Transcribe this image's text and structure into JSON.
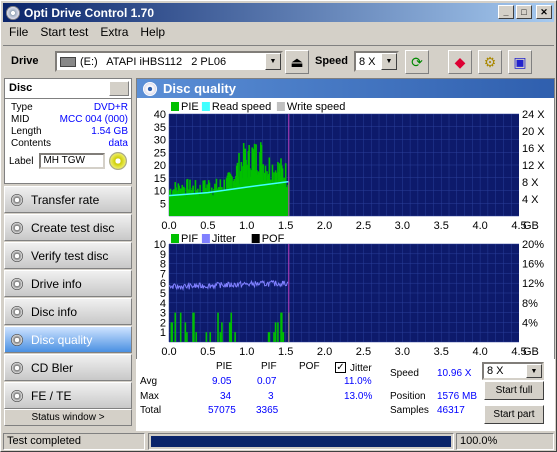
{
  "window": {
    "title": "Opti Drive Control 1.70"
  },
  "menu": [
    "File",
    "Start test",
    "Extra",
    "Help"
  ],
  "toolbar": {
    "drive_label": "Drive",
    "drive_value": "(E:)   ATAPI iHBS112   2 PL06",
    "speed_label": "Speed",
    "speed_value": "8 X"
  },
  "disc": {
    "header": "Disc",
    "rows": [
      {
        "k": "Type",
        "v": "DVD+R"
      },
      {
        "k": "MID",
        "v": "MCC 004 (000)"
      },
      {
        "k": "Length",
        "v": "1.54 GB"
      },
      {
        "k": "Contents",
        "v": "data"
      }
    ],
    "label_key": "Label",
    "label_value": "MH TGW"
  },
  "nav": [
    "Transfer rate",
    "Create test disc",
    "Verify test disc",
    "Drive info",
    "Disc info",
    "Disc quality",
    "CD Bler",
    "FE / TE"
  ],
  "nav_active": 5,
  "status_window": "Status window >",
  "panel_title": "Disc quality",
  "chart_data": [
    {
      "type": "bar",
      "legend": [
        {
          "name": "PIE",
          "color": "#00c000"
        },
        {
          "name": "Read speed",
          "color": "#40ffff"
        },
        {
          "name": "Write speed",
          "color": "#c0c0c0"
        }
      ],
      "xlabel_unit": "GB",
      "xlim": [
        0,
        4.5
      ],
      "xticks": [
        "0.0",
        "0.5",
        "1.0",
        "1.5",
        "2.0",
        "2.5",
        "3.0",
        "3.5",
        "4.0",
        "4.5"
      ],
      "ylim": [
        0,
        40
      ],
      "yticks_left": [
        "5",
        "10",
        "15",
        "20",
        "25",
        "30",
        "35",
        "40"
      ],
      "yticks_right": [
        "4 X",
        "8 X",
        "12 X",
        "16 X",
        "20 X",
        "24 X"
      ],
      "pie_profile": [
        [
          0,
          12
        ],
        [
          0.2,
          13
        ],
        [
          0.4,
          12
        ],
        [
          0.5,
          14
        ],
        [
          0.6,
          13
        ],
        [
          0.75,
          15
        ],
        [
          0.85,
          20
        ],
        [
          0.95,
          25
        ],
        [
          1.0,
          24
        ],
        [
          1.05,
          28
        ],
        [
          1.1,
          26
        ],
        [
          1.15,
          30
        ],
        [
          1.2,
          24
        ],
        [
          1.3,
          22
        ],
        [
          1.4,
          21
        ],
        [
          1.5,
          19
        ],
        [
          1.54,
          18
        ]
      ],
      "read_speed": [
        [
          0,
          4.8
        ],
        [
          0.5,
          5.5
        ],
        [
          1.0,
          6.8
        ],
        [
          1.54,
          8.1
        ]
      ]
    },
    {
      "type": "bar",
      "legend": [
        {
          "name": "PIF",
          "color": "#00c000"
        },
        {
          "name": "Jitter",
          "color": "#8080ff"
        },
        {
          "name": "POF",
          "color": "#000000"
        }
      ],
      "xlabel_unit": "GB",
      "xlim": [
        0,
        4.5
      ],
      "xticks": [
        "0.0",
        "0.5",
        "1.0",
        "1.5",
        "2.0",
        "2.5",
        "3.0",
        "3.5",
        "4.0",
        "4.5"
      ],
      "ylim": [
        0,
        10
      ],
      "yticks_left": [
        "1",
        "2",
        "3",
        "4",
        "5",
        "6",
        "7",
        "8",
        "9",
        "10"
      ],
      "yticks_right": [
        "4%",
        "8%",
        "12%",
        "16%",
        "20%"
      ],
      "jitter_pct": [
        [
          0,
          11.2
        ],
        [
          0.5,
          11.5
        ],
        [
          1.0,
          11.8
        ],
        [
          1.54,
          12.0
        ]
      ]
    }
  ],
  "stats": {
    "headers": [
      "PIE",
      "PIF",
      "POF"
    ],
    "jitter_label": "Jitter",
    "rows": [
      {
        "label": "Avg",
        "pie": "9.05",
        "pif": "0.07",
        "jitter": "11.0%"
      },
      {
        "label": "Max",
        "pie": "34",
        "pif": "3",
        "jitter": "13.0%"
      },
      {
        "label": "Total",
        "pie": "57075",
        "pif": "3365"
      }
    ],
    "speed_label": "Speed",
    "speed_value": "10.96 X",
    "position_label": "Position",
    "position_value": "1576 MB",
    "samples_label": "Samples",
    "samples_value": "46317",
    "speed_select": "8 X",
    "start_full": "Start full",
    "start_part": "Start part"
  },
  "statusbar": {
    "text": "Test completed",
    "progress": 1.0,
    "percent": "100.0%"
  }
}
